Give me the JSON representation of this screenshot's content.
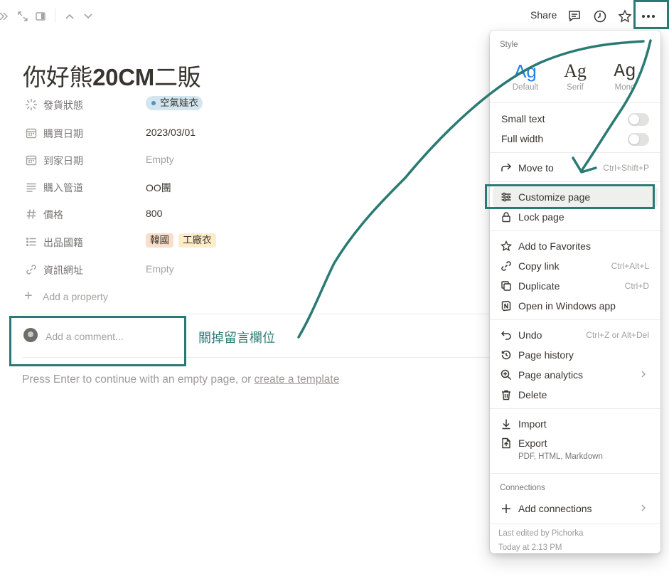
{
  "topbar": {
    "share_label": "Share",
    "icons": [
      "double-chevron-right-icon",
      "expand-icon",
      "sidebar-panel-icon",
      "chevron-up-icon",
      "chevron-down-icon",
      "comment-icon",
      "clock-icon",
      "star-icon",
      "more-icon"
    ]
  },
  "page": {
    "title_a": "你好熊",
    "title_b": "20CM",
    "title_c": "二販",
    "properties": [
      {
        "label": "發貨狀態",
        "value": "空氣娃衣",
        "type": "status"
      },
      {
        "label": "購買日期",
        "value": "2023/03/01",
        "type": "date"
      },
      {
        "label": "到家日期",
        "value": "Empty",
        "type": "date"
      },
      {
        "label": "購入管道",
        "value": "OO團",
        "type": "text"
      },
      {
        "label": "價格",
        "value": "800",
        "type": "number"
      },
      {
        "label": "出品國籍",
        "tags": [
          "韓國",
          "工廠衣"
        ],
        "type": "multi-select"
      },
      {
        "label": "資訊網址",
        "value": "Empty",
        "type": "url"
      }
    ],
    "add_property": "Add a property",
    "comment_placeholder": "Add a comment...",
    "hint_text": "Press Enter to continue with an empty page, or ",
    "hint_link": "create a template"
  },
  "annotation": {
    "text": "關掉留言欄位",
    "color": "#2a7a74"
  },
  "menu": {
    "style_header": "Style",
    "styles": [
      {
        "glyph": "Ag",
        "name": "Default"
      },
      {
        "glyph": "Ag",
        "name": "Serif"
      },
      {
        "glyph": "Ag",
        "name": "Mono"
      }
    ],
    "toggles": [
      {
        "label": "Small text",
        "on": false
      },
      {
        "label": "Full width",
        "on": false
      }
    ],
    "move_to": {
      "label": "Move to",
      "shortcut": "Ctrl+Shift+P"
    },
    "customize": "Customize page",
    "lock": "Lock page",
    "group3": [
      {
        "label": "Add to Favorites",
        "shortcut": ""
      },
      {
        "label": "Copy link",
        "shortcut": "Ctrl+Alt+L"
      },
      {
        "label": "Duplicate",
        "shortcut": "Ctrl+D"
      },
      {
        "label": "Open in Windows app",
        "shortcut": ""
      }
    ],
    "group4": [
      {
        "label": "Undo",
        "shortcut": "Ctrl+Z or Alt+Del"
      },
      {
        "label": "Page history",
        "shortcut": ""
      },
      {
        "label": "Page analytics",
        "shortcut": ""
      },
      {
        "label": "Delete",
        "shortcut": ""
      }
    ],
    "import": "Import",
    "export": "Export",
    "export_sub": "PDF, HTML, Markdown",
    "connections_header": "Connections",
    "add_connections": "Add connections",
    "last_edited": "Last edited by Pichorka",
    "last_edited_time": "Today at 2:13 PM"
  }
}
